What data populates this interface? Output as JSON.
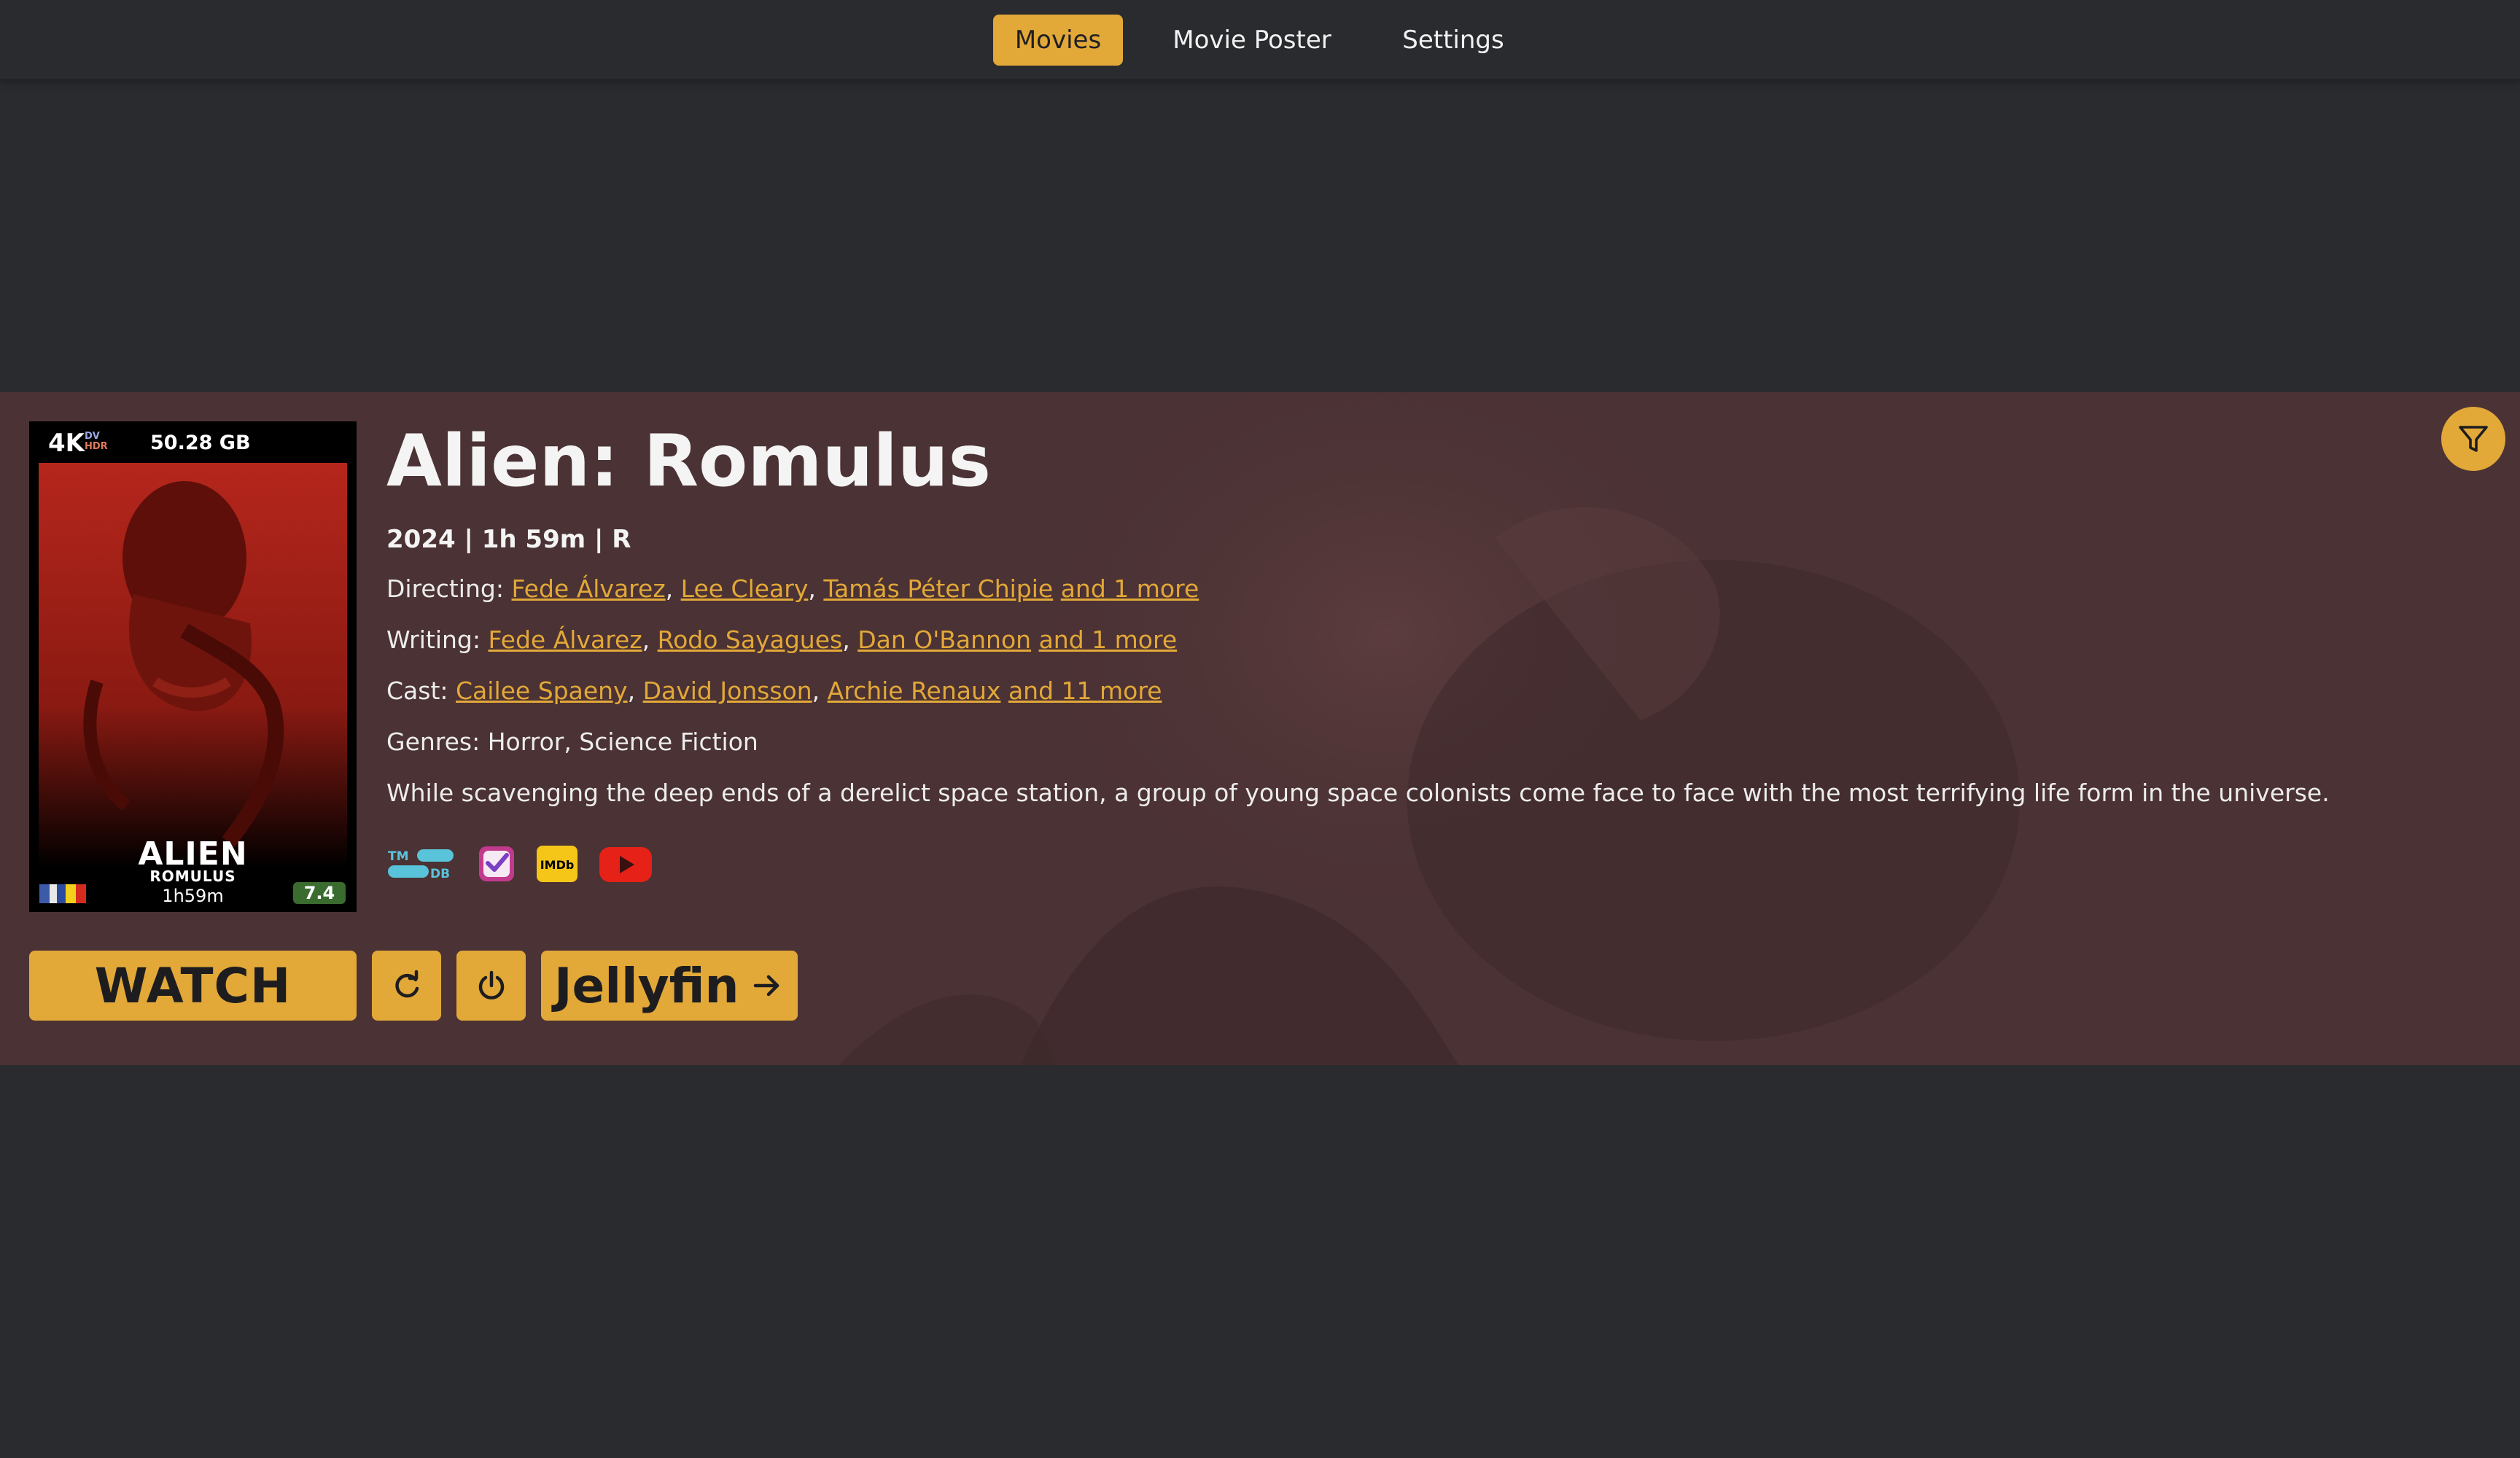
{
  "nav": {
    "tabs": [
      {
        "label": "Movies",
        "active": true
      },
      {
        "label": "Movie Poster",
        "active": false
      },
      {
        "label": "Settings",
        "active": false
      }
    ]
  },
  "movie": {
    "title": "Alien: Romulus",
    "meta": "2024 | 1h 59m | R",
    "directing": {
      "label": "Directing:",
      "names": [
        "Fede Álvarez",
        "Lee Cleary",
        "Tamás Péter Chipie"
      ],
      "more": "and 1 more"
    },
    "writing": {
      "label": "Writing:",
      "names": [
        "Fede Álvarez",
        "Rodo Sayagues",
        "Dan O'Bannon"
      ],
      "more": "and 1 more"
    },
    "cast": {
      "label": "Cast:",
      "names": [
        "Cailee Spaeny",
        "David Jonsson",
        "Archie Renaux"
      ],
      "more": "and 11 more"
    },
    "genres": "Genres: Horror, Science Fiction",
    "overview": "While scavenging the deep ends of a derelict space station, a group of young space colonists come face to face with the most terrifying life form in the universe."
  },
  "poster": {
    "resolution": "4K",
    "dv_line1": "DV",
    "dv_line2": "HDR",
    "file_size": "50.28 GB",
    "title": "ALIEN",
    "subtitle": "ROMULUS",
    "runtime": "1h59m",
    "rating": "7.4"
  },
  "external_links": [
    "tmdb-icon",
    "letterboxd-checklist-icon",
    "imdb-icon",
    "youtube-icon"
  ],
  "buttons": {
    "watch": "WATCH",
    "jellyfin": "Jellyfin"
  },
  "colors": {
    "accent": "#e2a838",
    "background": "#2a2b2f",
    "hero": "#4b3234",
    "link": "#e2a838",
    "rating_badge": "#3a6b2f"
  }
}
